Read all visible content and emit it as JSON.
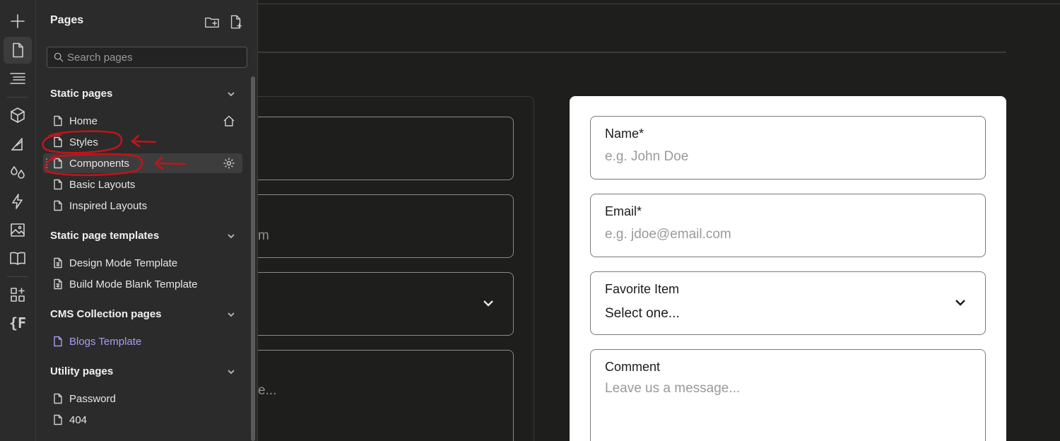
{
  "rail": {
    "icons": [
      "plus-icon",
      "page-icon",
      "navigator-icon",
      "components-cube-icon",
      "styles-icon",
      "variables-drops-icon",
      "interactions-bolt-icon",
      "assets-image-icon",
      "cms-book-icon",
      "apps-icon",
      "fonts-icon"
    ],
    "fonts_glyph": "{F"
  },
  "panel": {
    "title": "Pages",
    "search_placeholder": "Search pages",
    "sections": [
      {
        "label": "Static pages",
        "items": [
          "Home",
          "Styles",
          "Components",
          "Basic Layouts",
          "Inspired Layouts"
        ]
      },
      {
        "label": "Static page templates",
        "items": [
          "Design Mode Template",
          "Build Mode Blank Template"
        ]
      },
      {
        "label": "CMS Collection pages",
        "items": [
          "Blogs Template"
        ]
      },
      {
        "label": "Utility pages",
        "items": [
          "Password",
          "404"
        ]
      }
    ],
    "selected": "Components"
  },
  "colors": {
    "cms_accent": "#a99bf0",
    "annotation_red": "#c0141a",
    "panel_bg": "#2b2b2b",
    "canvas_bg": "#1e1e1c"
  },
  "dark_form": {
    "partial_texts": [
      "m",
      "e..."
    ]
  },
  "light_form": {
    "name_label": "Name*",
    "name_placeholder": "e.g. John Doe",
    "email_label": "Email*",
    "email_placeholder": "e.g. jdoe@email.com",
    "favorite_label": "Favorite Item",
    "favorite_value": "Select one...",
    "comment_label": "Comment",
    "comment_placeholder": "Leave us a message..."
  }
}
